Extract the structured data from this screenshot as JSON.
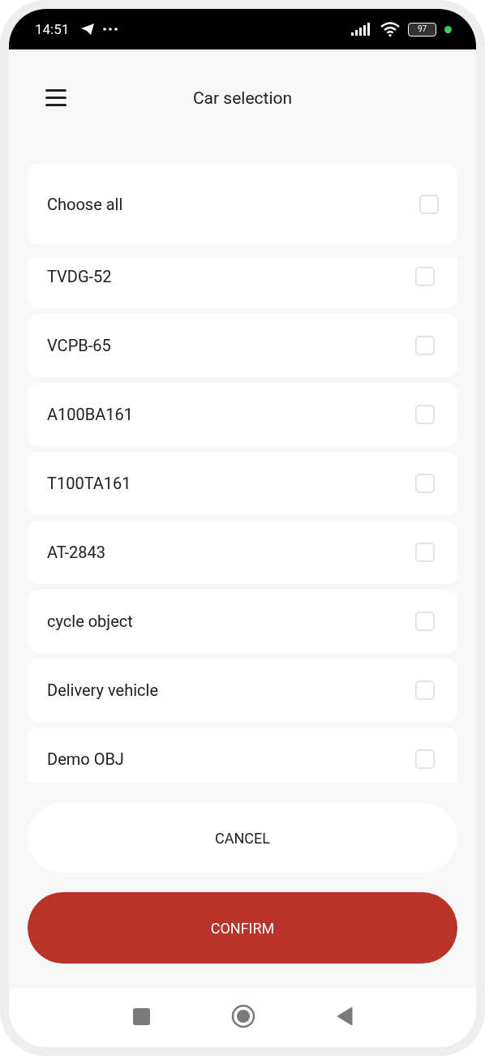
{
  "status_bar": {
    "time": "14:51",
    "battery": "97"
  },
  "header": {
    "title": "Car selection"
  },
  "choose_all": {
    "label": "Choose all",
    "checked": false
  },
  "cars": [
    {
      "label": "TVDG-52",
      "checked": false
    },
    {
      "label": "VCPB-65",
      "checked": false
    },
    {
      "label": "A100BA161",
      "checked": false
    },
    {
      "label": "T100TA161",
      "checked": false
    },
    {
      "label": "AT-2843",
      "checked": false
    },
    {
      "label": "cycle object",
      "checked": false
    },
    {
      "label": "Delivery vehicle",
      "checked": false
    },
    {
      "label": "Demo OBJ",
      "checked": false
    }
  ],
  "buttons": {
    "cancel": "CANCEL",
    "confirm": "CONFIRM"
  }
}
